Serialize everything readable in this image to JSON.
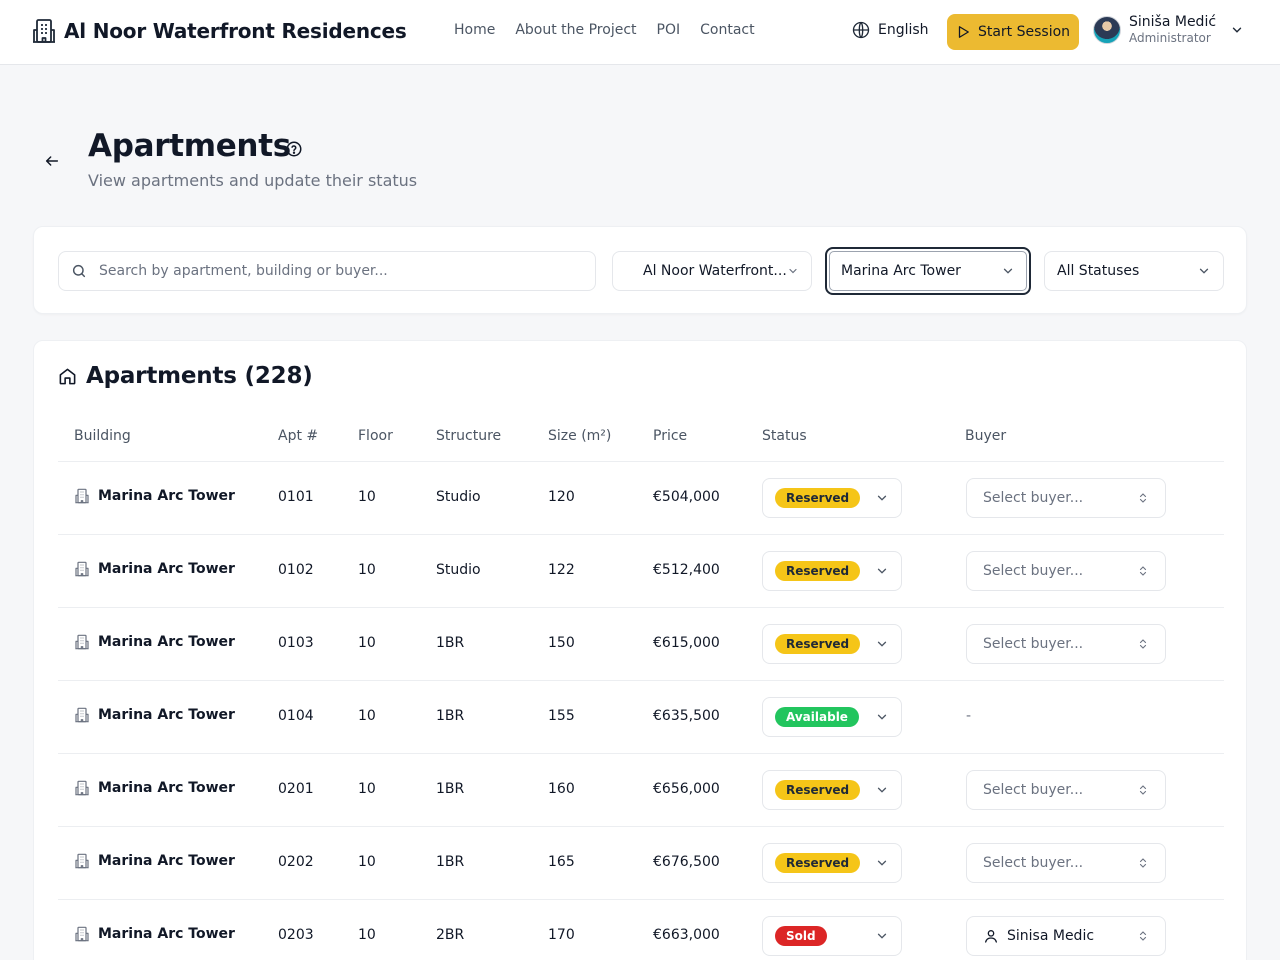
{
  "header": {
    "brand_title": "Al Noor Waterfront Residences",
    "nav": [
      "Home",
      "About the Project",
      "POI",
      "Contact"
    ],
    "language": "English",
    "start_session": "Start Session",
    "user": {
      "name": "Siniša Medić",
      "role": "Administrator"
    }
  },
  "page": {
    "title": "Apartments",
    "subtitle": "View apartments and update their status"
  },
  "filters": {
    "search_placeholder": "Search by apartment, building or buyer...",
    "project": "Al Noor Waterfront...",
    "building": "Marina Arc Tower",
    "status": "All Statuses"
  },
  "table": {
    "title": "Apartments (228)",
    "columns": [
      "Building",
      "Apt #",
      "Floor",
      "Structure",
      "Size (m²)",
      "Price",
      "Status",
      "Buyer"
    ],
    "rows": [
      {
        "building": "Marina Arc Tower",
        "apt": "0101",
        "floor": "10",
        "structure": "Studio",
        "size": "120",
        "price": "€504,000",
        "status": "Reserved",
        "buyer": "Select buyer..."
      },
      {
        "building": "Marina Arc Tower",
        "apt": "0102",
        "floor": "10",
        "structure": "Studio",
        "size": "122",
        "price": "€512,400",
        "status": "Reserved",
        "buyer": "Select buyer..."
      },
      {
        "building": "Marina Arc Tower",
        "apt": "0103",
        "floor": "10",
        "structure": "1BR",
        "size": "150",
        "price": "€615,000",
        "status": "Reserved",
        "buyer": "Select buyer..."
      },
      {
        "building": "Marina Arc Tower",
        "apt": "0104",
        "floor": "10",
        "structure": "1BR",
        "size": "155",
        "price": "€635,500",
        "status": "Available",
        "buyer": "-"
      },
      {
        "building": "Marina Arc Tower",
        "apt": "0201",
        "floor": "10",
        "structure": "1BR",
        "size": "160",
        "price": "€656,000",
        "status": "Reserved",
        "buyer": "Select buyer..."
      },
      {
        "building": "Marina Arc Tower",
        "apt": "0202",
        "floor": "10",
        "structure": "1BR",
        "size": "165",
        "price": "€676,500",
        "status": "Reserved",
        "buyer": "Select buyer..."
      },
      {
        "building": "Marina Arc Tower",
        "apt": "0203",
        "floor": "10",
        "structure": "2BR",
        "size": "170",
        "price": "€663,000",
        "status": "Sold",
        "buyer": "Sinisa Medic"
      }
    ]
  },
  "colors": {
    "accent": "#ecba31",
    "reserved": "#f5c518",
    "available": "#22c55e",
    "sold": "#dc2626"
  }
}
